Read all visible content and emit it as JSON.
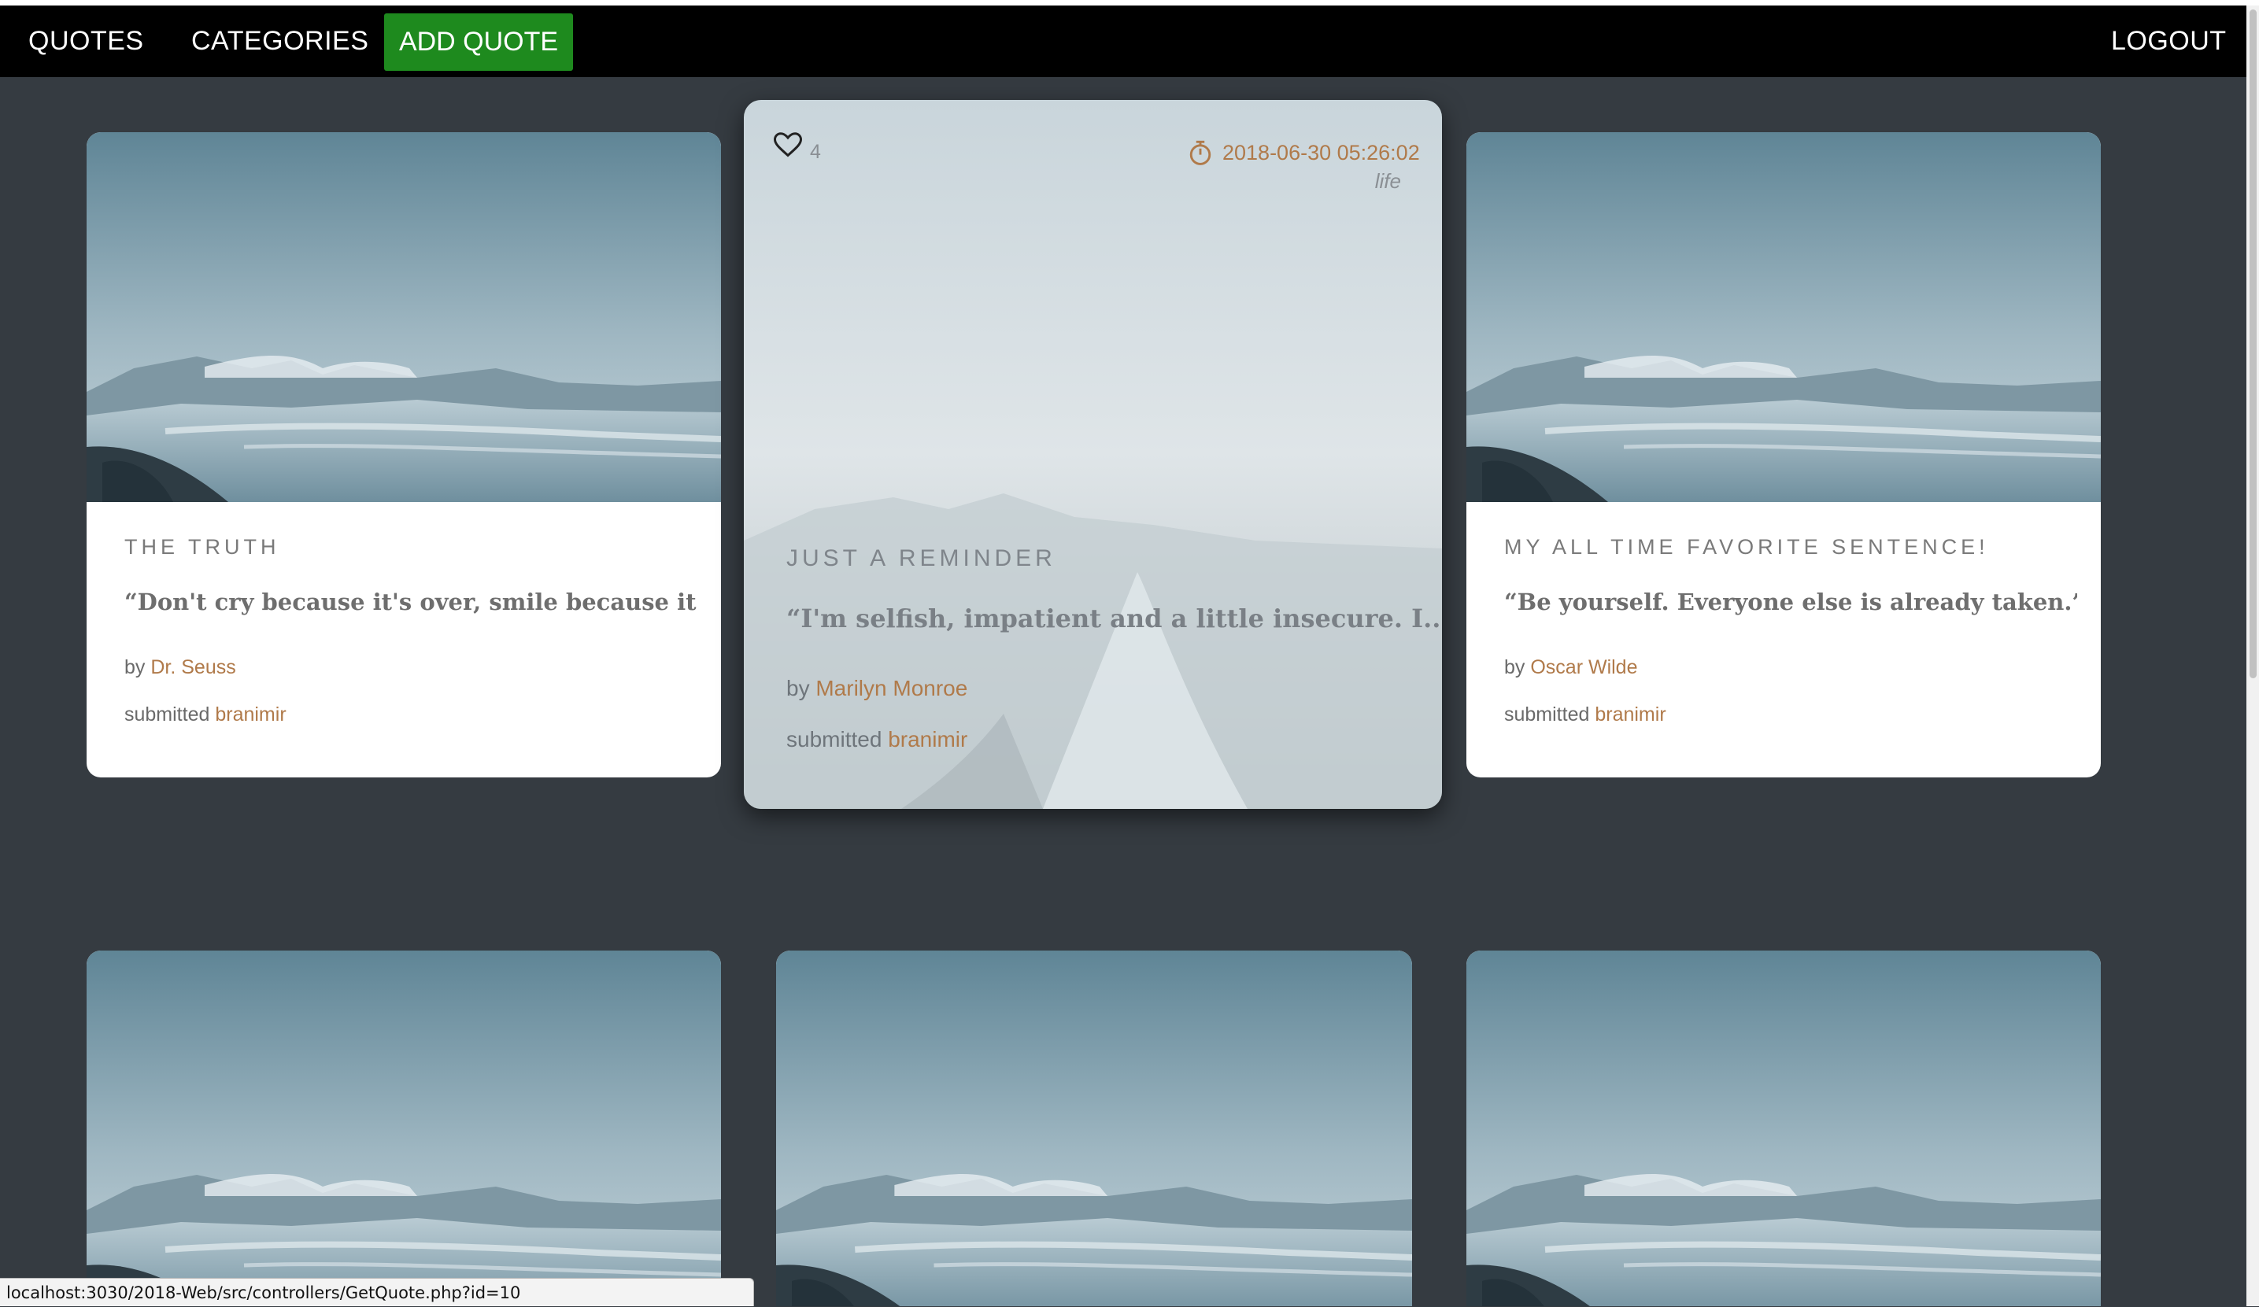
{
  "nav": {
    "quotes": "QUOTES",
    "categories": "CATEGORIES",
    "add_quote": "ADD QUOTE",
    "logout": "LOGOUT"
  },
  "featured": {
    "likes": "4",
    "date": "2018-06-30 05:26:02",
    "category": "life",
    "title": "JUST A REMINDER",
    "quote": "“I'm selfish, impatient and a little insecure. I...",
    "by_label": "by",
    "author": "Marilyn Monroe",
    "submitted_label": "submitted",
    "submitter": "branimir"
  },
  "cards": [
    {
      "title": "THE TRUTH",
      "quote": "“Don't cry because it's over, smile because it h...",
      "by_label": "by",
      "author": "Dr. Seuss",
      "submitted_label": "submitted",
      "submitter": "branimir"
    },
    {
      "title": "MY ALL TIME FAVORITE SENTENCE!",
      "quote": "“Be yourself. Everyone else is already taken.”...",
      "by_label": "by",
      "author": "Oscar Wilde",
      "submitted_label": "submitted",
      "submitter": "branimir"
    }
  ],
  "status_url": "localhost:3030/2018-Web/src/controllers/GetQuote.php?id=10",
  "colors": {
    "background": "#353b41",
    "accent_link": "#b07a4a",
    "add_button": "#1e8a1e",
    "navbar": "#000000"
  }
}
